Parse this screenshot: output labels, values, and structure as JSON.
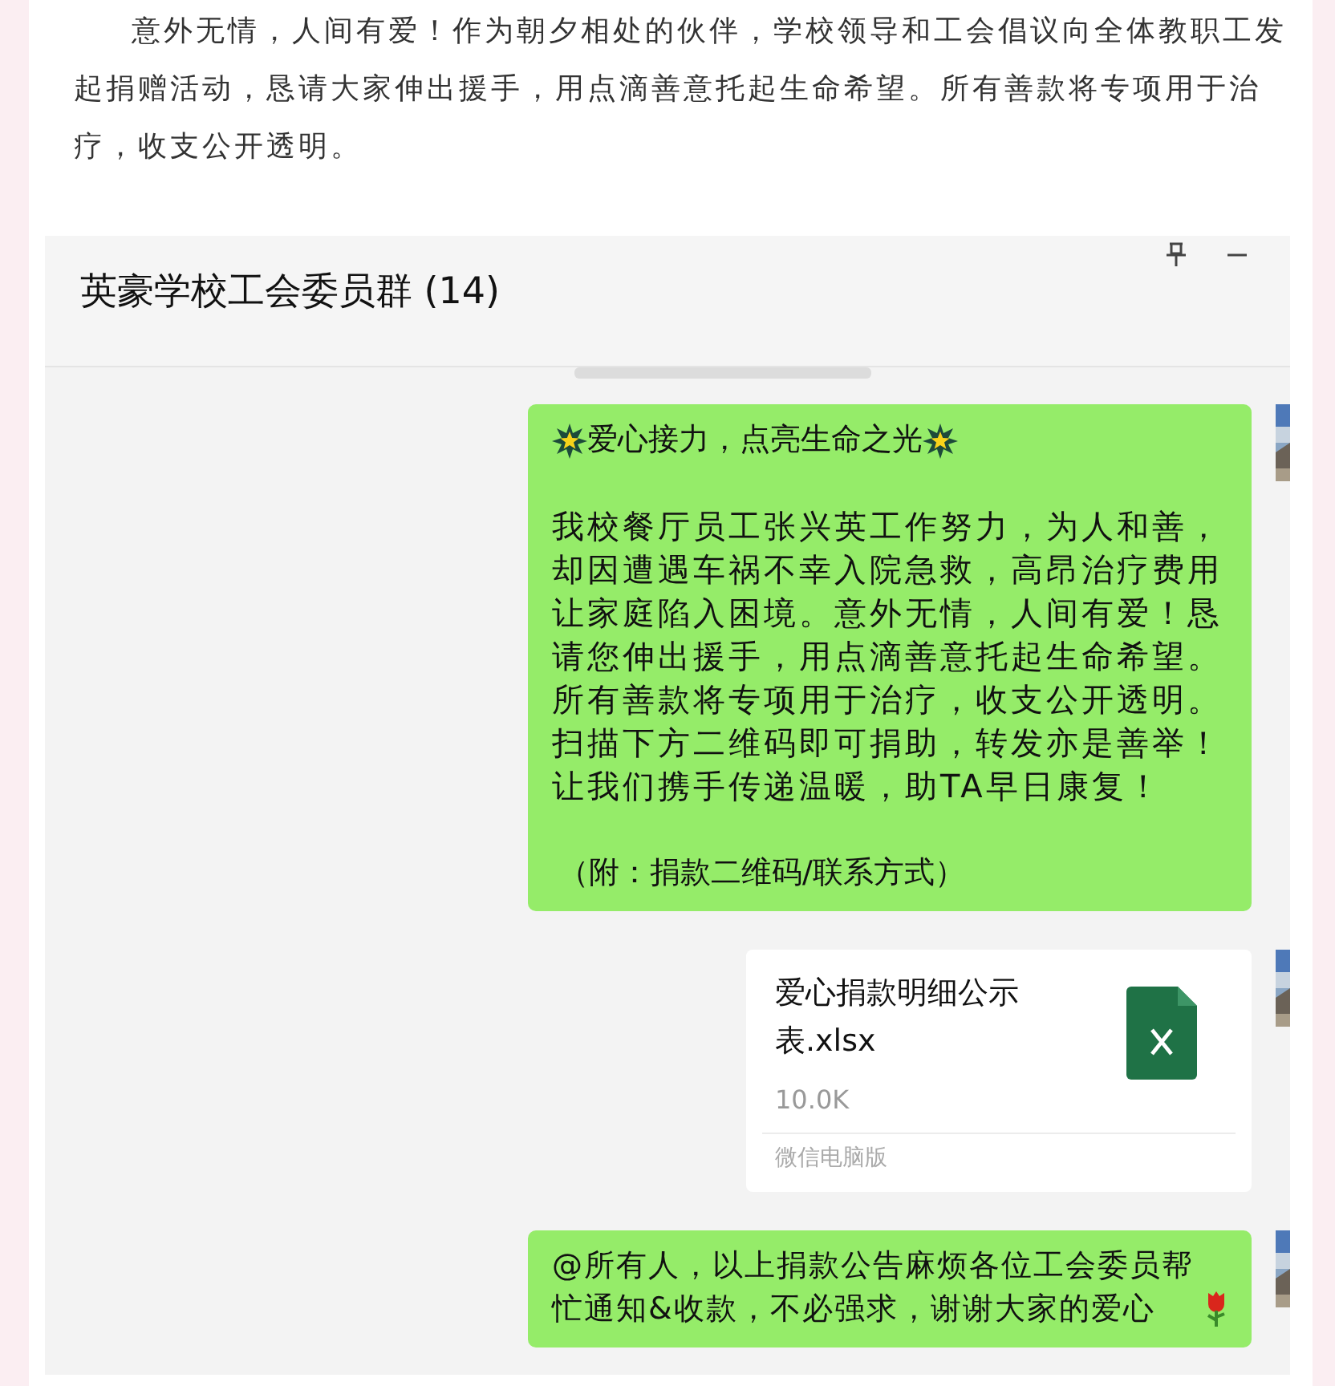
{
  "article": {
    "paragraph": "意外无情，人间有爱！作为朝夕相处的伙伴，学校领导和工会倡议向全体教职工发起捐赠活动，恳请大家伸出援手，用点滴善意托起生命希望。所有善款将专项用于治疗，收支公开透明。"
  },
  "chat": {
    "title": "英豪学校工会委员群 (14)",
    "messages": [
      {
        "kind": "announcement",
        "heading": "爱心接力，点亮生命之光",
        "body": "我校餐厅员工张兴英工作努力，为人和善，却因遭遇车祸不幸入院急救，高昂治疗费用让家庭陷入困境。意外无情，人间有爱！恳请您伸出援手，用点滴善意托起生命希望。所有善款将专项用于治疗，收支公开透明。扫描下方二维码即可捐助，转发亦是善举！让我们携手传递温暖，助TA早日康复！",
        "note": "（附：捐款二维码/联系方式）"
      },
      {
        "kind": "file",
        "name": "爱心捐款明细公示表.xlsx",
        "size": "10.0K",
        "source": "微信电脑版"
      },
      {
        "kind": "text",
        "text": "@所有人，以上捐款公告麻烦各位工会委员帮忙通知&收款，不必强求，谢谢大家的爱心"
      }
    ]
  }
}
